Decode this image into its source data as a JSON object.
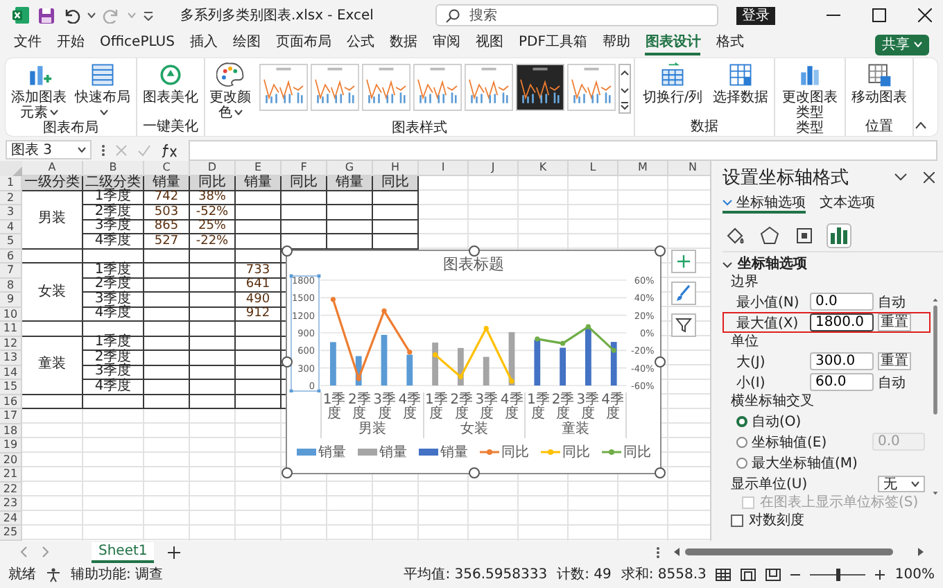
{
  "title_bar": {
    "title": "多系列多类别图表.xlsx - Excel",
    "search_placeholder": "搜索",
    "sign_in": "登录"
  },
  "menu_tabs": [
    {
      "label": "文件",
      "selected": false
    },
    {
      "label": "开始",
      "selected": false
    },
    {
      "label": "OfficePLUS",
      "selected": false
    },
    {
      "label": "插入",
      "selected": false
    },
    {
      "label": "绘图",
      "selected": false
    },
    {
      "label": "页面布局",
      "selected": false
    },
    {
      "label": "公式",
      "selected": false
    },
    {
      "label": "数据",
      "selected": false
    },
    {
      "label": "审阅",
      "selected": false
    },
    {
      "label": "视图",
      "selected": false
    },
    {
      "label": "PDF工具箱",
      "selected": false
    },
    {
      "label": "帮助",
      "selected": false
    },
    {
      "label": "图表设计",
      "selected": true
    },
    {
      "label": "格式",
      "selected": false
    }
  ],
  "share": "共享",
  "ribbon": [
    {
      "label": "图表布局",
      "buttons": [
        {
          "kind": "add-element",
          "label": "添加图表元素",
          "dropdown": true
        },
        {
          "kind": "layout",
          "label": "快速布局",
          "dropdown": true
        }
      ]
    },
    {
      "label": "一键美化",
      "buttons": [
        {
          "kind": "beautify",
          "label": "图表美化",
          "dropdown": false
        }
      ]
    },
    {
      "label": "图表样式",
      "buttons": [
        {
          "kind": "colors",
          "label": "更改颜色",
          "dropdown": true
        }
      ],
      "gallery": [
        {
          "kind": "light"
        },
        {
          "kind": "light"
        },
        {
          "kind": "light"
        },
        {
          "kind": "light"
        },
        {
          "kind": "light"
        },
        {
          "kind": "dark"
        },
        {
          "kind": "light"
        }
      ]
    },
    {
      "label": "数据",
      "buttons": [
        {
          "kind": "switch",
          "label": "切换行/列",
          "dropdown": false
        },
        {
          "kind": "select-data",
          "label": "选择数据",
          "dropdown": false
        }
      ]
    },
    {
      "label": "类型",
      "buttons": [
        {
          "kind": "change-type",
          "label": "更改图表类型",
          "dropdown": false
        }
      ]
    },
    {
      "label": "位置",
      "buttons": [
        {
          "kind": "move",
          "label": "移动图表",
          "dropdown": false
        }
      ]
    }
  ],
  "formula_bar": {
    "name_box": "图表 3"
  },
  "sheet": {
    "columns": [
      "A",
      "B",
      "C",
      "D",
      "E",
      "F",
      "G",
      "H",
      "I",
      "J",
      "K",
      "L",
      "M",
      "N"
    ],
    "row_numbers": [
      "1",
      "2",
      "3",
      "4",
      "5",
      "6",
      "7",
      "8",
      "9",
      "10",
      "11",
      "12",
      "13",
      "14",
      "15",
      "16",
      "17",
      "18",
      "19",
      "20",
      "21",
      "22",
      "23",
      "24",
      "25"
    ],
    "header": [
      "一级分类",
      "二级分类",
      "销量",
      "同比",
      "销量",
      "同比",
      "销量",
      "同比"
    ],
    "groups": [
      {
        "label": "男装",
        "rows": [
          {
            "label": "1季度",
            "values": {
              "C": "742",
              "D": "38%"
            }
          },
          {
            "label": "2季度",
            "values": {
              "C": "503",
              "D": "-52%"
            }
          },
          {
            "label": "3季度",
            "values": {
              "C": "865",
              "D": "25%"
            }
          },
          {
            "label": "4季度",
            "values": {
              "C": "527",
              "D": "-22%"
            }
          }
        ]
      },
      {
        "label": "女装",
        "rows": [
          {
            "label": "1季度",
            "values": {
              "E": "733"
            }
          },
          {
            "label": "2季度",
            "values": {
              "E": "641"
            }
          },
          {
            "label": "3季度",
            "values": {
              "E": "490"
            }
          },
          {
            "label": "4季度",
            "values": {
              "E": "912"
            }
          }
        ]
      },
      {
        "label": "童装",
        "rows": [
          {
            "label": "1季度",
            "values": {}
          },
          {
            "label": "2季度",
            "values": {}
          },
          {
            "label": "3季度",
            "values": {}
          },
          {
            "label": "4季度",
            "values": {}
          }
        ]
      }
    ]
  },
  "chart": {
    "category_groups": [
      "男装",
      "女装",
      "童装"
    ],
    "chart_data": {
      "type": "bar",
      "title": "图表标题",
      "categories": [
        "1季度",
        "2季度",
        "3季度",
        "4季度",
        "1季度",
        "2季度",
        "3季度",
        "4季度",
        "1季度",
        "2季度",
        "3季度",
        "4季度"
      ],
      "ylim": [
        0,
        1800
      ],
      "yticks": [
        0,
        300,
        600,
        900,
        1200,
        1500,
        1800
      ],
      "y2lim": [
        -0.6,
        0.6
      ],
      "y2ticks": [
        {
          "value": -0.6,
          "label": "-60%"
        },
        {
          "value": -0.4,
          "label": "-40%"
        },
        {
          "value": -0.2,
          "label": "-20%"
        },
        {
          "value": 0,
          "label": "0%"
        },
        {
          "value": 0.2,
          "label": "20%"
        },
        {
          "value": 0.4,
          "label": "40%"
        },
        {
          "value": 0.6,
          "label": "60%"
        }
      ],
      "grid": true,
      "legend": "bottom",
      "series": [
        {
          "name": "销量",
          "type": "bar",
          "color": "#5b9bd5",
          "values": [
            742,
            503,
            865,
            527,
            null,
            null,
            null,
            null,
            null,
            null,
            null,
            null
          ]
        },
        {
          "name": "销量",
          "type": "bar",
          "color": "#a5a5a5",
          "values": [
            null,
            null,
            null,
            null,
            733,
            641,
            490,
            912,
            null,
            null,
            null,
            null
          ]
        },
        {
          "name": "销量",
          "type": "bar",
          "color": "#4472c4",
          "values": [
            null,
            null,
            null,
            null,
            null,
            null,
            null,
            null,
            780,
            645,
            980,
            745
          ]
        },
        {
          "name": "同比",
          "type": "line",
          "axis": "y2",
          "marker": true,
          "color": "#ed7d31",
          "values": [
            0.38,
            -0.52,
            0.25,
            -0.22,
            null,
            null,
            null,
            null,
            null,
            null,
            null,
            null
          ]
        },
        {
          "name": "同比",
          "type": "line",
          "axis": "y2",
          "marker": true,
          "color": "#ffc000",
          "values": [
            null,
            null,
            null,
            null,
            -0.25,
            -0.5,
            0.05,
            -0.55,
            null,
            null,
            null,
            null
          ]
        },
        {
          "name": "同比",
          "type": "line",
          "axis": "y2",
          "marker": true,
          "color": "#70ad47",
          "values": [
            null,
            null,
            null,
            null,
            null,
            null,
            null,
            null,
            -0.07,
            -0.12,
            0.07,
            -0.2
          ]
        }
      ]
    }
  },
  "pane": {
    "title": "设置坐标轴格式",
    "tabs": [
      {
        "label": "坐标轴选项",
        "selected": true
      },
      {
        "label": "文本选项",
        "selected": false
      }
    ],
    "icon_tabs": [
      {
        "kind": "fill",
        "selected": false
      },
      {
        "kind": "effects",
        "selected": false
      },
      {
        "kind": "size",
        "selected": false
      },
      {
        "kind": "axis",
        "selected": true
      }
    ],
    "section": {
      "label": "坐标轴选项",
      "expanded": true
    },
    "rows": [
      {
        "kind": "heading",
        "label": "边界"
      },
      {
        "kind": "field",
        "label": "最小值(N)",
        "value": "0.0",
        "action": {
          "kind": "text",
          "label": "自动"
        },
        "highlighted": false
      },
      {
        "kind": "field",
        "label": "最大值(X)",
        "value": "1800.0",
        "action": {
          "kind": "button",
          "label": "重置"
        },
        "highlighted": true
      },
      {
        "kind": "heading",
        "label": "单位"
      },
      {
        "kind": "field",
        "label": "大(J)",
        "value": "300.0",
        "action": {
          "kind": "button",
          "label": "重置"
        },
        "highlighted": false
      },
      {
        "kind": "field",
        "label": "小(I)",
        "value": "60.0",
        "action": {
          "kind": "text",
          "label": "自动"
        },
        "highlighted": false
      },
      {
        "kind": "heading",
        "label": "横坐标轴交叉"
      },
      {
        "kind": "radio",
        "label": "自动(O)",
        "selected": true
      },
      {
        "kind": "radio",
        "label": "坐标轴值(E)",
        "selected": false,
        "value": "0.0",
        "disabled": true
      },
      {
        "kind": "radio",
        "label": "最大坐标轴值(M)",
        "selected": false
      },
      {
        "kind": "select",
        "label": "显示单位(U)",
        "value": "无"
      },
      {
        "kind": "checkbox",
        "label": "在图表上显示单位标签(S)",
        "checked": false,
        "disabled": true
      },
      {
        "kind": "checkbox",
        "label": "对数刻度",
        "checked": false,
        "disabled": false
      }
    ]
  },
  "sheet_tabs": [
    {
      "label": "Sheet1",
      "selected": true
    }
  ],
  "status_bar": {
    "ready": "就绪",
    "accessibility": "辅助功能: 调查",
    "stats": [
      "平均值: 356.5958333",
      "计数: 49",
      "求和: 8558.3"
    ],
    "zoom": {
      "level": 0.5,
      "reading": "100%"
    }
  }
}
